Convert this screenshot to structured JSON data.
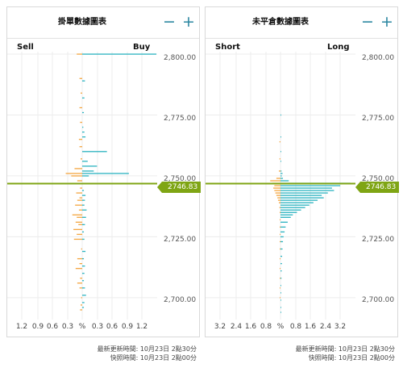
{
  "colors": {
    "sell": "#f4a641",
    "buy": "#2bb3c0",
    "price": "#7fa514",
    "accent": "#2a86a0"
  },
  "orders_panel": {
    "title": "掛單數據圖表",
    "minus_icon": "−",
    "plus_icon": "+",
    "left_label": "Sell",
    "right_label": "Buy",
    "x_ticks": [
      "1.2",
      "0.9",
      "0.6",
      "0.3",
      "%",
      "0.3",
      "0.6",
      "0.9",
      "1.2"
    ],
    "y_ticks": [
      "2,800.00",
      "2,775.00",
      "2,750.00",
      "2,725.00",
      "2,700.00"
    ],
    "price": "2746.83",
    "footer_line1": "最新更新時間: 10月23日 2點30分",
    "footer_line2": "快照時間: 10月23日 2點00分"
  },
  "positions_panel": {
    "title": "未平倉數據圖表",
    "minus_icon": "−",
    "plus_icon": "+",
    "left_label": "Short",
    "right_label": "Long",
    "x_ticks": [
      "3.2",
      "2.4",
      "1.6",
      "0.8",
      "%",
      "0.8",
      "1.6",
      "2.4",
      "3.2"
    ],
    "y_ticks": [
      "2,800.00",
      "2,775.00",
      "2,750.00",
      "2,725.00",
      "2,700.00"
    ],
    "price": "2746.83",
    "footer_line1": "最新更新時間: 10月23日 2點30分",
    "footer_line2": "快照時間: 10月23日 2點00分"
  },
  "chart_data": [
    {
      "type": "bar",
      "title": "掛單數據圖表",
      "xlabel": "%",
      "x_range": [
        -1.35,
        1.35
      ],
      "ylim": [
        2691,
        2801
      ],
      "current_price": 2746.83,
      "series": [
        {
          "name": "Sell",
          "bars": [
            [
              2800,
              0.1
            ],
            [
              2790,
              0.05
            ],
            [
              2784,
              0.03
            ],
            [
              2778,
              0.05
            ],
            [
              2772,
              0.04
            ],
            [
              2765,
              0.06
            ],
            [
              2762,
              0.05
            ],
            [
              2757,
              0.03
            ],
            [
              2753,
              0.14
            ],
            [
              2751,
              0.3
            ],
            [
              2750,
              0.2
            ],
            [
              2748,
              0.09
            ],
            [
              2745,
              0.04
            ],
            [
              2743,
              0.11
            ],
            [
              2741,
              0.05
            ],
            [
              2740,
              0.09
            ],
            [
              2738,
              0.13
            ],
            [
              2736,
              0.06
            ],
            [
              2734,
              0.18
            ],
            [
              2733,
              0.1
            ],
            [
              2731,
              0.12
            ],
            [
              2730,
              0.07
            ],
            [
              2728,
              0.16
            ],
            [
              2726,
              0.1
            ],
            [
              2724,
              0.15
            ],
            [
              2720,
              0.02
            ],
            [
              2716,
              0.09
            ],
            [
              2714,
              0.05
            ],
            [
              2712,
              0.12
            ],
            [
              2708,
              0.04
            ],
            [
              2706,
              0.09
            ],
            [
              2704,
              0.05
            ],
            [
              2700,
              0.02
            ],
            [
              2697,
              0.03
            ],
            [
              2695,
              0.04
            ]
          ]
        },
        {
          "name": "Buy",
          "bars": [
            [
              2800,
              1.35
            ],
            [
              2789,
              0.05
            ],
            [
              2782,
              0.04
            ],
            [
              2776,
              0.03
            ],
            [
              2770,
              0.02
            ],
            [
              2768,
              0.04
            ],
            [
              2766,
              0.06
            ],
            [
              2760,
              0.45
            ],
            [
              2756,
              0.1
            ],
            [
              2754,
              0.27
            ],
            [
              2752,
              0.21
            ],
            [
              2751,
              0.85
            ],
            [
              2750,
              0.12
            ],
            [
              2744,
              0.03
            ],
            [
              2742,
              0.06
            ],
            [
              2740,
              0.05
            ],
            [
              2738,
              0.04
            ],
            [
              2736,
              0.08
            ],
            [
              2733,
              0.07
            ],
            [
              2730,
              0.05
            ],
            [
              2727,
              0.03
            ],
            [
              2724,
              0.04
            ],
            [
              2719,
              0.06
            ],
            [
              2716,
              0.03
            ],
            [
              2713,
              0.05
            ],
            [
              2710,
              0.04
            ],
            [
              2707,
              0.03
            ],
            [
              2704,
              0.05
            ],
            [
              2701,
              0.07
            ],
            [
              2698,
              0.04
            ],
            [
              2696,
              0.03
            ]
          ]
        }
      ]
    },
    {
      "type": "bar",
      "title": "未平倉數據圖表",
      "xlabel": "%",
      "x_range": [
        -3.6,
        3.6
      ],
      "ylim": [
        2691,
        2801
      ],
      "current_price": 2746.83,
      "series": [
        {
          "name": "Short",
          "bars": [
            [
              2764,
              0.05
            ],
            [
              2757,
              0.05
            ],
            [
              2752,
              0.08
            ],
            [
              2749,
              0.2
            ],
            [
              2748,
              0.5
            ],
            [
              2747,
              0.4
            ],
            [
              2746,
              0.3
            ],
            [
              2745,
              0.35
            ],
            [
              2744,
              0.3
            ],
            [
              2743,
              0.25
            ],
            [
              2742,
              0.2
            ],
            [
              2741,
              0.15
            ],
            [
              2740,
              0.12
            ],
            [
              2739,
              0.08
            ],
            [
              2737,
              0.05
            ],
            [
              2735,
              0.03
            ],
            [
              2732,
              0.03
            ],
            [
              2729,
              0.02
            ],
            [
              2726,
              0.02
            ],
            [
              2723,
              0.02
            ],
            [
              2720,
              0.01
            ],
            [
              2716,
              0.01
            ],
            [
              2712,
              0.01
            ],
            [
              2708,
              0.01
            ],
            [
              2704,
              0.01
            ],
            [
              2700,
              0.01
            ]
          ]
        },
        {
          "name": "Long",
          "bars": [
            [
              2775,
              0.02
            ],
            [
              2766,
              0.03
            ],
            [
              2760,
              0.02
            ],
            [
              2756,
              0.03
            ],
            [
              2752,
              0.05
            ],
            [
              2751,
              0.1
            ],
            [
              2750,
              0.06
            ],
            [
              2749,
              0.12
            ],
            [
              2748,
              0.4
            ],
            [
              2747,
              3.4
            ],
            [
              2746,
              2.9
            ],
            [
              2745,
              2.5
            ],
            [
              2744,
              2.6
            ],
            [
              2743,
              2.3
            ],
            [
              2742,
              2.0
            ],
            [
              2741,
              2.1
            ],
            [
              2740,
              1.8
            ],
            [
              2739,
              1.6
            ],
            [
              2738,
              1.4
            ],
            [
              2737,
              1.2
            ],
            [
              2736,
              1.0
            ],
            [
              2735,
              0.8
            ],
            [
              2734,
              0.6
            ],
            [
              2733,
              0.5
            ],
            [
              2731,
              0.35
            ],
            [
              2729,
              0.25
            ],
            [
              2727,
              0.2
            ],
            [
              2725,
              0.15
            ],
            [
              2723,
              0.12
            ],
            [
              2720,
              0.1
            ],
            [
              2717,
              0.08
            ],
            [
              2714,
              0.07
            ],
            [
              2711,
              0.06
            ],
            [
              2708,
              0.05
            ],
            [
              2705,
              0.04
            ],
            [
              2702,
              0.04
            ],
            [
              2699,
              0.03
            ],
            [
              2696,
              0.03
            ],
            [
              2694,
              0.04
            ]
          ]
        }
      ]
    }
  ]
}
